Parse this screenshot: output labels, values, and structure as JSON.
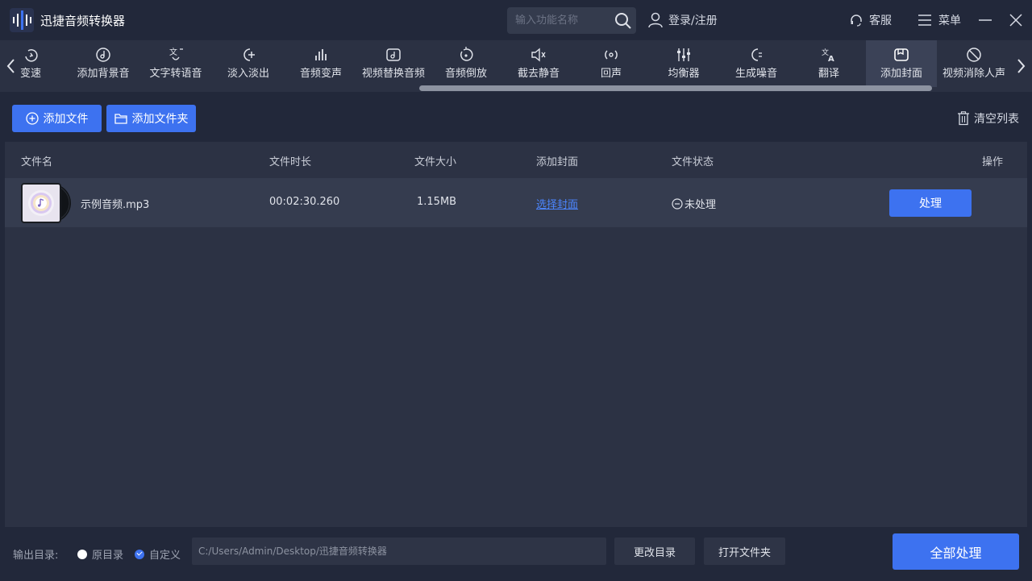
{
  "app": {
    "title": "迅捷音频转换器"
  },
  "search": {
    "placeholder": "输入功能名称"
  },
  "header": {
    "login": "登录/注册",
    "service": "客服",
    "menu": "菜单"
  },
  "toolbar": {
    "tools": [
      {
        "label": "变速",
        "icon": "speed-icon"
      },
      {
        "label": "添加背景音",
        "icon": "music-note-icon"
      },
      {
        "label": "文字转语音",
        "icon": "text-to-speech-icon"
      },
      {
        "label": "淡入淡出",
        "icon": "fade-icon"
      },
      {
        "label": "音频变声",
        "icon": "bars-icon"
      },
      {
        "label": "视频替换音频",
        "icon": "video-audio-icon"
      },
      {
        "label": "音频倒放",
        "icon": "reverse-icon"
      },
      {
        "label": "截去静音",
        "icon": "mute-icon"
      },
      {
        "label": "回声",
        "icon": "echo-icon"
      },
      {
        "label": "均衡器",
        "icon": "equalizer-icon"
      },
      {
        "label": "生成噪音",
        "icon": "noise-icon"
      },
      {
        "label": "翻译",
        "icon": "translate-icon"
      },
      {
        "label": "添加封面",
        "icon": "cover-icon"
      },
      {
        "label": "视频消除人声",
        "icon": "vocal-remove-icon"
      }
    ],
    "active_index": 12
  },
  "actions": {
    "add_file": "添加文件",
    "add_folder": "添加文件夹",
    "clear_list": "清空列表"
  },
  "table": {
    "headers": {
      "name": "文件名",
      "duration": "文件时长",
      "size": "文件大小",
      "cover": "添加封面",
      "status": "文件状态",
      "action": "操作"
    },
    "rows": [
      {
        "name": "示例音频.mp3",
        "duration": "00:02:30.260",
        "size": "1.15MB",
        "cover": "选择封面",
        "status": "未处理",
        "action": "处理"
      }
    ]
  },
  "footer": {
    "output_label": "输出目录:",
    "option_original": "原目录",
    "option_custom": "自定义",
    "selected_option": "custom",
    "path": "C:/Users/Admin/Desktop/迅捷音频转换器",
    "change_dir": "更改目录",
    "open_folder": "打开文件夹",
    "process_all": "全部处理"
  },
  "colors": {
    "accent": "#3d72f0",
    "link": "#4c86ff",
    "background": "#22283a",
    "panel": "#2c3244"
  }
}
